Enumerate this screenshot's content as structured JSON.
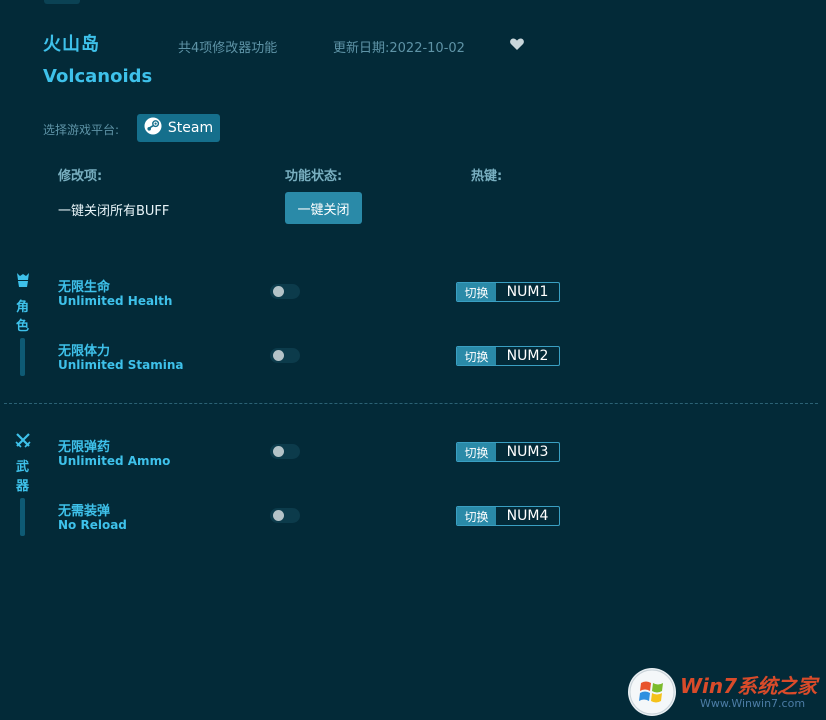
{
  "game": {
    "title_cn": "火山岛",
    "title_en": "Volcanoids",
    "feature_count": "共4项修改器功能",
    "update_date": "更新日期:2022-10-02"
  },
  "platform": {
    "label": "选择游戏平台:",
    "button": "Steam",
    "icon": "steam-icon"
  },
  "columns": {
    "mod": "修改项:",
    "status": "功能状态:",
    "hotkey": "热键:"
  },
  "global": {
    "label": "一键关闭所有BUFF",
    "button": "一键关闭"
  },
  "categories": [
    {
      "label": "角色",
      "icon": "character-icon",
      "items": [
        {
          "name_cn": "无限生命",
          "name_en": "Unlimited Health",
          "switch_label": "切换",
          "key": "NUM1",
          "enabled": false
        },
        {
          "name_cn": "无限体力",
          "name_en": "Unlimited Stamina",
          "switch_label": "切换",
          "key": "NUM2",
          "enabled": false
        }
      ]
    },
    {
      "label": "武器",
      "icon": "crossed-swords-icon",
      "items": [
        {
          "name_cn": "无限弹药",
          "name_en": "Unlimited Ammo",
          "switch_label": "切换",
          "key": "NUM3",
          "enabled": false
        },
        {
          "name_cn": "无需装弹",
          "name_en": "No Reload",
          "switch_label": "切换",
          "key": "NUM4",
          "enabled": false
        }
      ]
    }
  ],
  "watermark": {
    "text": "Win7系统之家",
    "url": "Www.Winwin7.com"
  },
  "colors": {
    "background": "#032a38",
    "accent": "#3ec1ea",
    "button": "#2a8aa8"
  }
}
